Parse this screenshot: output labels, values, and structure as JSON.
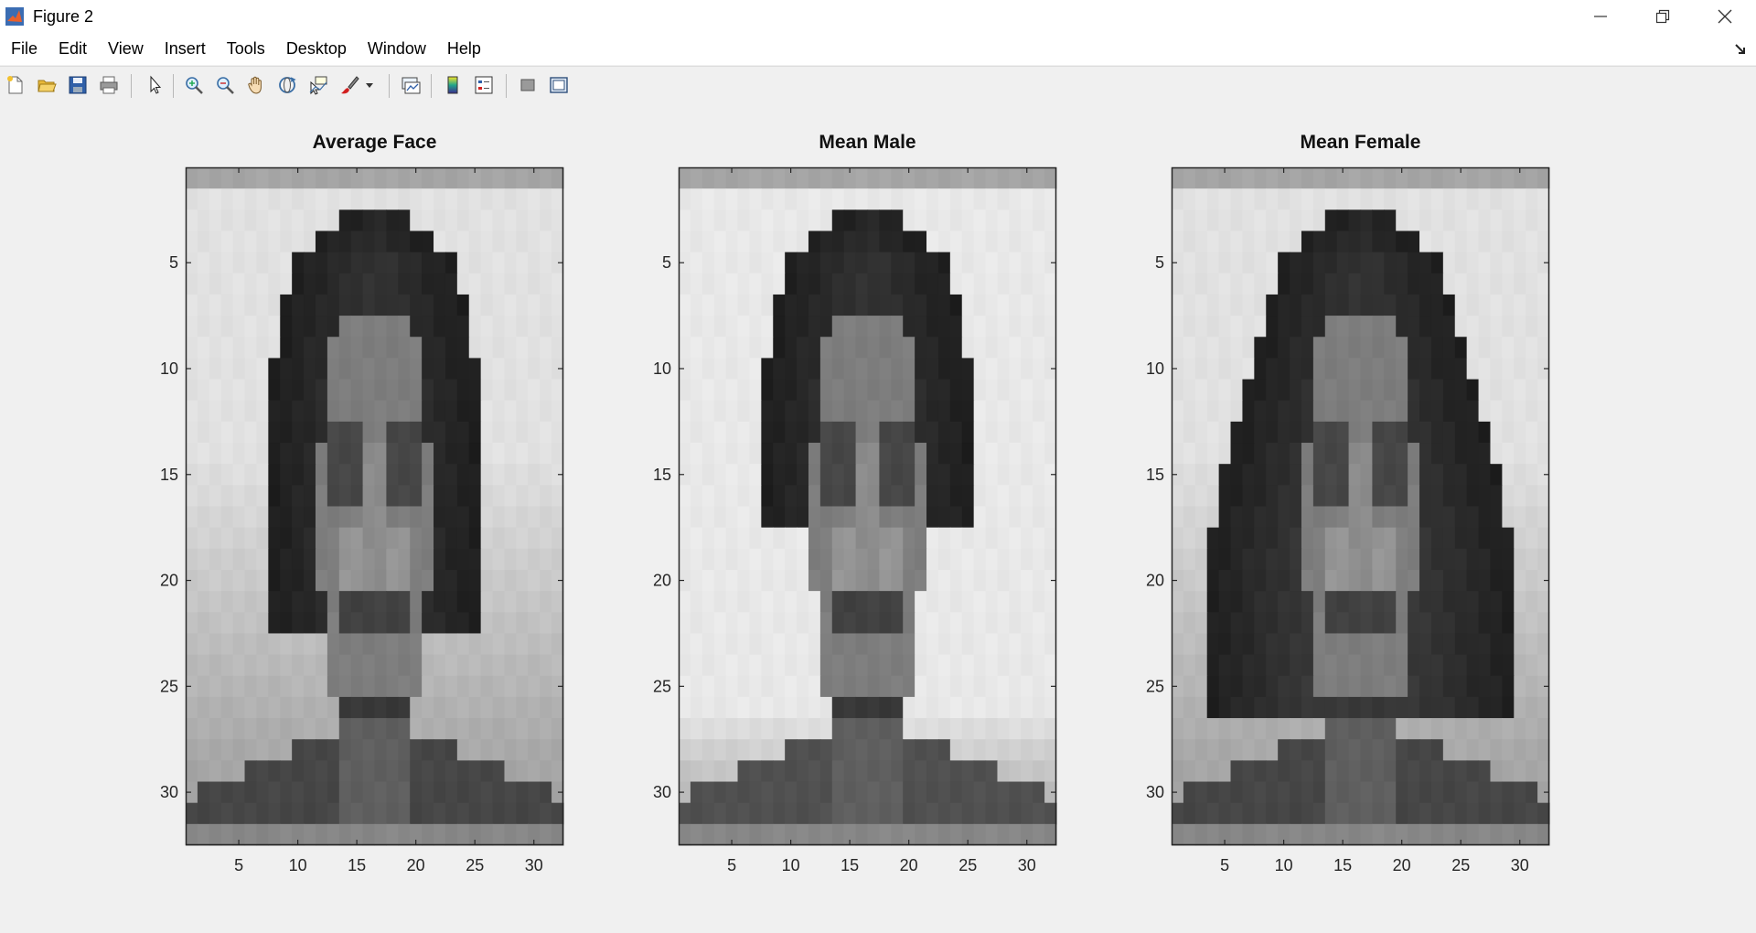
{
  "window": {
    "title": "Figure 2"
  },
  "menu": [
    "File",
    "Edit",
    "View",
    "Insert",
    "Tools",
    "Desktop",
    "Window",
    "Help"
  ],
  "toolbar": {
    "buttons": [
      "new-figure-icon",
      "open-file-icon",
      "save-icon",
      "print-icon",
      "edit-plot-arrow-icon",
      "zoom-in-icon",
      "zoom-out-icon",
      "pan-hand-icon",
      "rotate-3d-icon",
      "data-cursor-icon",
      "brush-icon",
      "brush-dropdown-icon",
      "link-plot-icon",
      "colorbar-icon",
      "legend-icon",
      "hide-plot-tools-icon",
      "show-plot-tools-icon"
    ]
  },
  "colors": {
    "title_text": "#111111",
    "axis": "#262626",
    "background": "#f0f0f0"
  },
  "axes": [
    {
      "title": "Average Face",
      "variant": "average"
    },
    {
      "title": "Mean Male",
      "variant": "male"
    },
    {
      "title": "Mean Female",
      "variant": "female"
    }
  ],
  "chart_data": [
    {
      "type": "heatmap",
      "title": "Average Face",
      "colormap": "gray",
      "rows": 32,
      "cols": 32,
      "xlim": [
        0.5,
        32.5
      ],
      "ylim": [
        0.5,
        32.5
      ],
      "xticks": [
        5,
        10,
        15,
        20,
        25,
        30
      ],
      "yticks": [
        5,
        10,
        15,
        20,
        25,
        30
      ],
      "y_reversed": true
    },
    {
      "type": "heatmap",
      "title": "Mean Male",
      "colormap": "gray",
      "rows": 32,
      "cols": 32,
      "xlim": [
        0.5,
        32.5
      ],
      "ylim": [
        0.5,
        32.5
      ],
      "xticks": [
        5,
        10,
        15,
        20,
        25,
        30
      ],
      "yticks": [
        5,
        10,
        15,
        20,
        25,
        30
      ],
      "y_reversed": true
    },
    {
      "type": "heatmap",
      "title": "Mean Female",
      "colormap": "gray",
      "rows": 32,
      "cols": 32,
      "xlim": [
        0.5,
        32.5
      ],
      "ylim": [
        0.5,
        32.5
      ],
      "xticks": [
        5,
        10,
        15,
        20,
        25,
        30
      ],
      "yticks": [
        5,
        10,
        15,
        20,
        25,
        30
      ],
      "y_reversed": true
    }
  ]
}
